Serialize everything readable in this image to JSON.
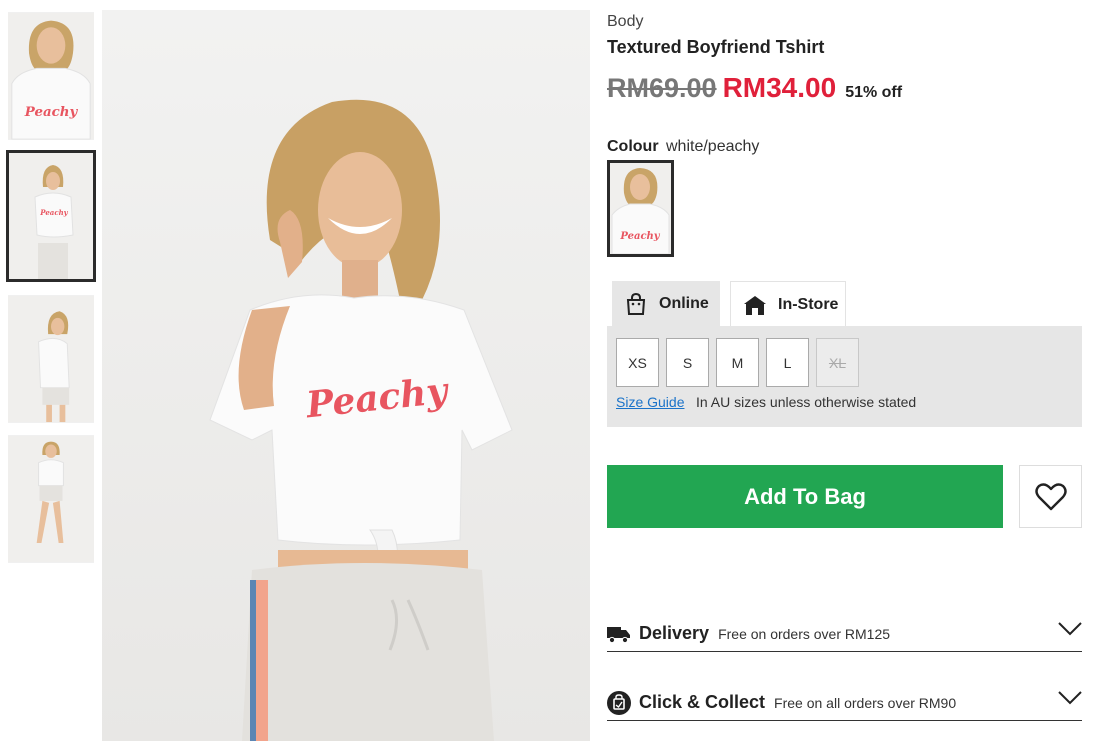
{
  "product": {
    "brand": "Body",
    "title": "Textured Boyfriend Tshirt",
    "price_original": "RM69.00",
    "price_sale": "RM34.00",
    "discount": "51% off"
  },
  "colour": {
    "label": "Colour",
    "value": "white/peachy"
  },
  "tshirt_print": "Peachy",
  "stock_tabs": [
    {
      "label": "Online",
      "icon": "shopping-bag-icon"
    },
    {
      "label": "In-Store",
      "icon": "store-icon"
    }
  ],
  "sizes": [
    {
      "label": "XS",
      "available": true
    },
    {
      "label": "S",
      "available": true
    },
    {
      "label": "M",
      "available": true
    },
    {
      "label": "L",
      "available": true
    },
    {
      "label": "XL",
      "available": false
    }
  ],
  "size_guide": {
    "link": "Size Guide",
    "note": "In AU sizes unless otherwise stated"
  },
  "add_to_bag": "Add To Bag",
  "accordions": [
    {
      "title": "Delivery",
      "subtitle": "Free on orders over RM125",
      "icon": "truck-icon"
    },
    {
      "title": "Click & Collect",
      "subtitle": "Free on all orders over RM90",
      "icon": "collect-icon"
    }
  ],
  "colors": {
    "sale_red": "#e0203a",
    "add_to_bag_green": "#22a652",
    "link_blue": "#1a73c9",
    "panel_grey": "#e6e6e6"
  }
}
